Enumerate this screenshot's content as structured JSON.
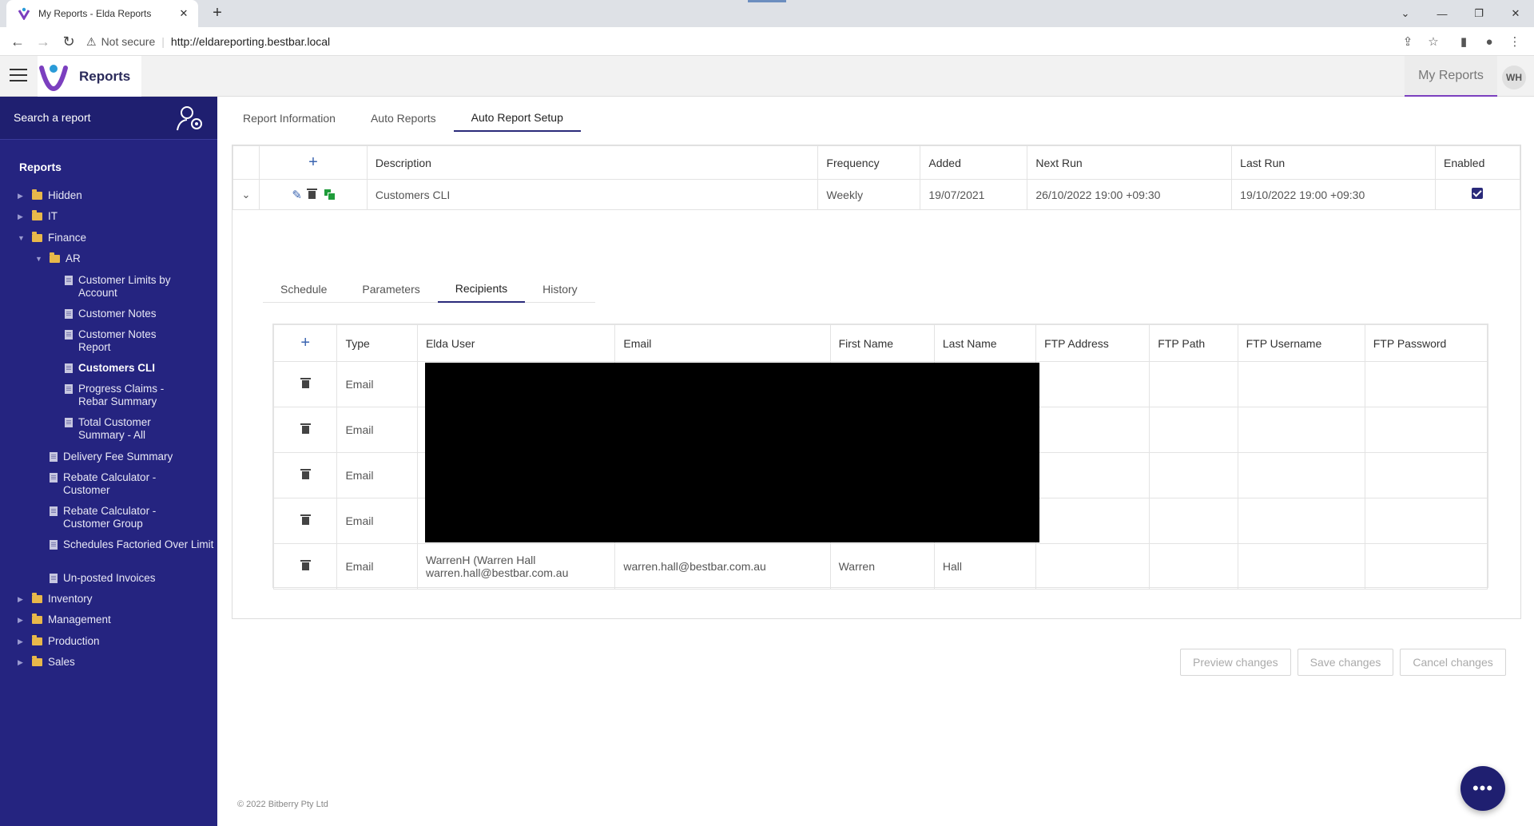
{
  "browser": {
    "tab_title": "My Reports - Elda Reports",
    "security_label": "Not secure",
    "url": "http://eldareporting.bestbar.local"
  },
  "header": {
    "brand": "Reports",
    "my_reports": "My Reports",
    "avatar_initials": "WH"
  },
  "sidebar": {
    "search_label": "Search a report",
    "title": "Reports",
    "tree": {
      "hidden": "Hidden",
      "it": "IT",
      "finance": "Finance",
      "ar": "AR",
      "ar_customer_limits": "Customer Limits by Account",
      "ar_customer_notes": "Customer Notes",
      "ar_customer_notes_report": "Customer Notes Report",
      "ar_customers_cli": "Customers CLI",
      "ar_progress_claims": "Progress Claims - Rebar Summary",
      "ar_total_customer": "Total Customer Summary - All",
      "delivery_fee": "Delivery Fee Summary",
      "rebate_customer": "Rebate Calculator - Customer",
      "rebate_group": "Rebate Calculator - Customer Group",
      "schedules_factoried": "Schedules Factoried Over Limit",
      "unposted": "Un-posted Invoices",
      "inventory": "Inventory",
      "management": "Management",
      "production": "Production",
      "sales": "Sales"
    }
  },
  "main": {
    "tabs": [
      "Report Information",
      "Auto Reports",
      "Auto Report Setup"
    ],
    "jobs_table": {
      "headers": [
        "Description",
        "Frequency",
        "Added",
        "Next Run",
        "Last Run",
        "Enabled"
      ],
      "row": {
        "description": "Customers CLI",
        "frequency": "Weekly",
        "added": "19/07/2021",
        "next_run": "26/10/2022 19:00 +09:30",
        "last_run": "19/10/2022 19:00 +09:30",
        "enabled": true
      }
    },
    "subtabs": [
      "Schedule",
      "Parameters",
      "Recipients",
      "History"
    ],
    "recipients": {
      "headers": [
        "Type",
        "Elda User",
        "Email",
        "First Name",
        "Last Name",
        "FTP Address",
        "FTP Path",
        "FTP Username",
        "FTP Password"
      ],
      "rows": [
        {
          "type": "Email",
          "elda_user": "",
          "email": "",
          "first_name": "",
          "last_name": ""
        },
        {
          "type": "Email",
          "elda_user": "",
          "email": "",
          "first_name": "",
          "last_name": ""
        },
        {
          "type": "Email",
          "elda_user": "",
          "email": "",
          "first_name": "",
          "last_name": ""
        },
        {
          "type": "Email",
          "elda_user": "",
          "email": "",
          "first_name": "",
          "last_name": ""
        },
        {
          "type": "Email",
          "elda_user_line1": "WarrenH (Warren Hall",
          "elda_user_line2": "warren.hall@bestbar.com.au",
          "email": "warren.hall@bestbar.com.au",
          "first_name": "Warren",
          "last_name": "Hall"
        }
      ]
    },
    "buttons": {
      "preview": "Preview changes",
      "save": "Save changes",
      "cancel": "Cancel changes"
    },
    "footer": "© 2022 Bitberry Pty Ltd"
  },
  "colors": {
    "sidebar_bg": "#252480",
    "accent": "#2a2a7a",
    "header_underline": "#7b3fbf",
    "enabled_check": "#2a2a7a"
  }
}
